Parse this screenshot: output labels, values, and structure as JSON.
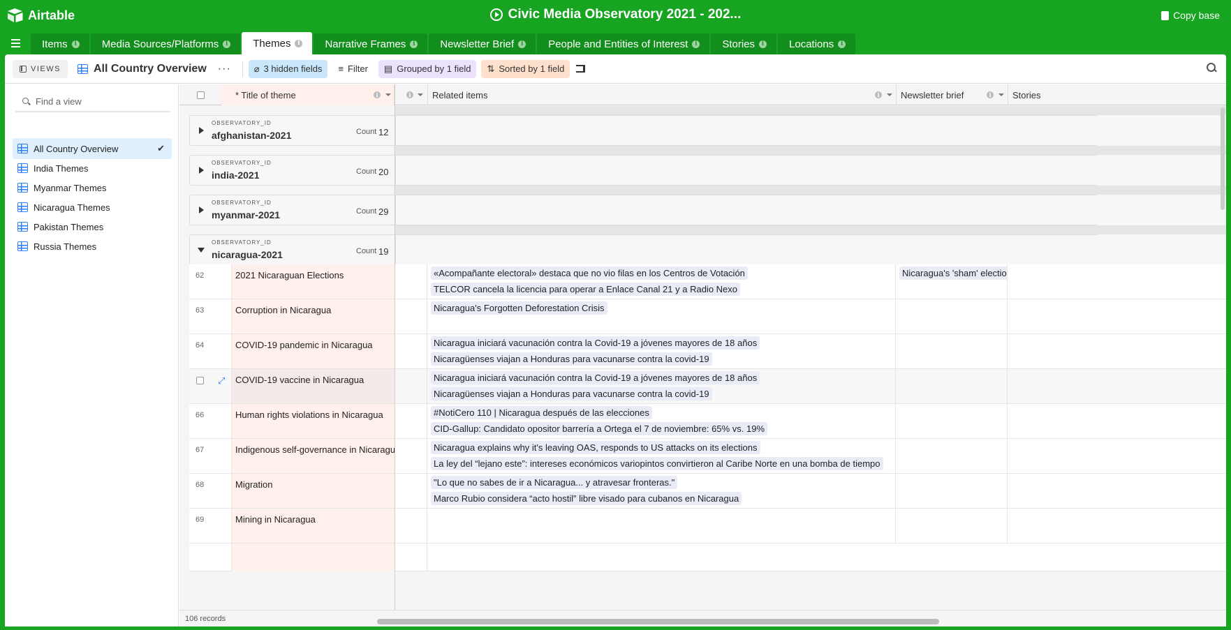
{
  "app": {
    "name": "Airtable",
    "base_title": "Civic Media Observatory 2021 - 202...",
    "copy_base_label": "Copy base"
  },
  "tabs": [
    {
      "label": "Items"
    },
    {
      "label": "Media Sources/Platforms"
    },
    {
      "label": "Themes",
      "active": true
    },
    {
      "label": "Narrative Frames"
    },
    {
      "label": "Newsletter Brief"
    },
    {
      "label": "People and Entities of Interest"
    },
    {
      "label": "Stories"
    },
    {
      "label": "Locations"
    }
  ],
  "toolbar": {
    "views_label": "VIEWS",
    "view_name": "All Country Overview",
    "more_label": "···",
    "hidden_fields_label": "3 hidden fields",
    "filter_label": "Filter",
    "grouped_label": "Grouped by 1 field",
    "sorted_label": "Sorted by 1 field"
  },
  "sidebar": {
    "find_placeholder": "Find a view",
    "views": [
      {
        "label": "All Country Overview",
        "active": true
      },
      {
        "label": "India Themes"
      },
      {
        "label": "Myanmar Themes"
      },
      {
        "label": "Nicaragua Themes"
      },
      {
        "label": "Pakistan Themes"
      },
      {
        "label": "Russia Themes"
      }
    ]
  },
  "grid": {
    "columns": {
      "title": "* Title of theme",
      "related": "Related items",
      "newsletter": "Newsletter brief",
      "stories": "Stories"
    },
    "group_field": "OBSERVATORY_ID",
    "count_label": "Count",
    "groups": [
      {
        "value": "afghanistan-2021",
        "count": "12",
        "open": false
      },
      {
        "value": "india-2021",
        "count": "20",
        "open": false
      },
      {
        "value": "myanmar-2021",
        "count": "29",
        "open": false
      },
      {
        "value": "nicaragua-2021",
        "count": "19",
        "open": true
      }
    ],
    "rows": [
      {
        "num": "62",
        "title": "2021 Nicaraguan Elections",
        "related": [
          "«Acompañante electoral» destaca que no vio filas en los Centros de Votación",
          "TELCOR cancela la licencia para operar a Enlace Canal 21 y a Radio Nexo"
        ],
        "newsletter": "Nicaragua's 'sham' election"
      },
      {
        "num": "63",
        "title": "Corruption in Nicaragua",
        "related": [
          "Nicaragua's Forgotten Deforestation Crisis"
        ],
        "newsletter": ""
      },
      {
        "num": "64",
        "title": "COVID-19 pandemic in Nicaragua",
        "related": [
          "Nicaragua iniciará vacunación contra la Covid-19 a jóvenes mayores de 18 años",
          "Nicaragüenses viajan a Honduras para vacunarse contra la covid-19"
        ],
        "newsletter": ""
      },
      {
        "num": "",
        "title": "COVID-19 vaccine in Nicaragua",
        "related": [
          "Nicaragua iniciará vacunación contra la Covid-19 a jóvenes mayores de 18 años",
          "Nicaragüenses viajan a Honduras para vacunarse contra la covid-19"
        ],
        "newsletter": "",
        "hover": true
      },
      {
        "num": "66",
        "title": "Human rights violations in Nicaragua",
        "related": [
          "#NotiCero 110 | Nicaragua después de las elecciones",
          "CID-Gallup: Candidato opositor barrería a Ortega el 7 de noviembre: 65% vs. 19%"
        ],
        "newsletter": ""
      },
      {
        "num": "67",
        "title": "Indigenous self-governance in Nicaragua",
        "related": [
          "Nicaragua explains why it's leaving OAS, responds to US attacks on its elections",
          "La ley del “lejano este”: intereses económicos variopintos convirtieron al Caribe Norte en una bomba de tiempo"
        ],
        "newsletter": ""
      },
      {
        "num": "68",
        "title": "Migration",
        "related": [
          "\"Lo que no sabes de ir a Nicaragua... y atravesar fronteras.\"",
          "Marco Rubio considera “acto hostil” libre visado para cubanos en Nicaragua"
        ],
        "newsletter": ""
      },
      {
        "num": "69",
        "title": "Mining in Nicaragua",
        "related": [],
        "newsletter": ""
      }
    ],
    "record_count": "106 records"
  }
}
